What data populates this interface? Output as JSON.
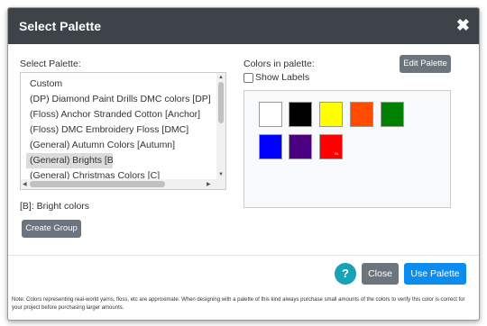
{
  "dialog": {
    "title": "Select Palette",
    "close_glyph": "✖"
  },
  "left": {
    "select_label": "Select Palette:",
    "items": [
      "Custom",
      "(DP) Diamond Paint Drills DMC colors [DP]",
      "(Floss) Anchor Stranded Cotton [Anchor]",
      "(Floss) DMC Embroidery Floss [DMC]",
      "(General) Autumn Colors [Autumn]",
      "(General) Brights [B]",
      "(General) Christmas Colors [C]"
    ],
    "selected_index": 5,
    "description": "[B]: Bright colors",
    "create_group_label": "Create Group"
  },
  "right": {
    "colors_label": "Colors in palette:",
    "edit_palette_label": "Edit Palette",
    "show_labels_label": "Show Labels",
    "show_labels_checked": false,
    "swatches": [
      {
        "color": "#ffffff",
        "label": ""
      },
      {
        "color": "#000000",
        "label": ""
      },
      {
        "color": "#ffff00",
        "label": ""
      },
      {
        "color": "#ff4a00",
        "label": ""
      },
      {
        "color": "#008000",
        "label": ""
      },
      {
        "color": "#0000ff",
        "label": ""
      },
      {
        "color": "#4b0082",
        "label": ""
      },
      {
        "color": "#ff0000",
        "label": "BL"
      }
    ]
  },
  "footer": {
    "help_glyph": "?",
    "close_label": "Close",
    "use_palette_label": "Use Palette",
    "note": "Note: Colors representing real-world yarns, floss, etc are approximate. When designing with a palette of this kind always purchase small amounts of the colors to verify this color is correct for your project before purchasing larger amounts."
  }
}
